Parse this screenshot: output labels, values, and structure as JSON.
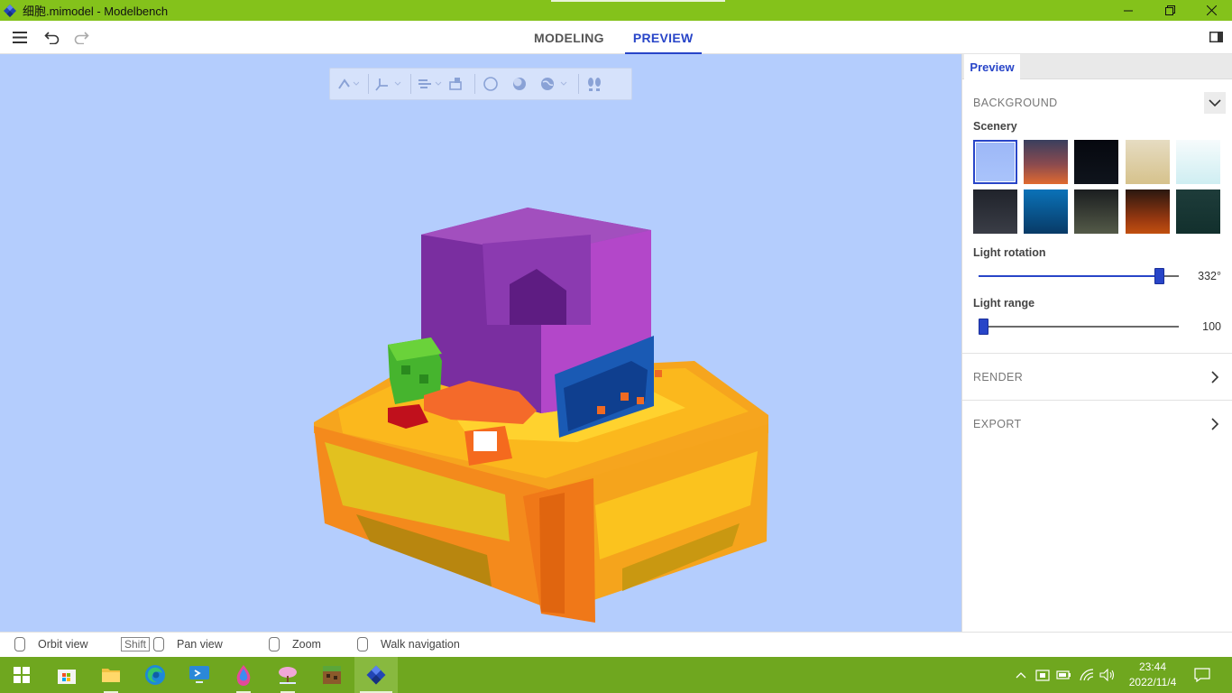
{
  "window": {
    "title": "细胞.mimodel - Modelbench",
    "icon": "modelbench-diamond-icon",
    "controls": [
      "minimize-icon",
      "restore-icon",
      "close-icon"
    ]
  },
  "toolbar": {
    "menu_icon": "hamburger-menu-icon",
    "undo_icon": "undo-icon",
    "redo_icon": "redo-icon",
    "tabs": [
      {
        "label": "MODELING",
        "active": false
      },
      {
        "label": "PREVIEW",
        "active": true
      }
    ],
    "panel_toggle_icon": "panel-toggle-icon"
  },
  "viewport": {
    "floating_toolbar": [
      "snap-icon",
      "axis-icon",
      "wind-icon",
      "texture-icon",
      "shape-icon",
      "shading-icon",
      "globe-icon",
      "footsteps-icon"
    ],
    "background_color": "#b4cdfd"
  },
  "panel": {
    "tab": "Preview",
    "background": {
      "header": "BACKGROUND",
      "scenery_label": "Scenery",
      "scenery": [
        {
          "name": "sky-blue",
          "selected": true
        },
        {
          "name": "dusk"
        },
        {
          "name": "night"
        },
        {
          "name": "sand"
        },
        {
          "name": "ice"
        },
        {
          "name": "dark-gray"
        },
        {
          "name": "ocean"
        },
        {
          "name": "olive-night"
        },
        {
          "name": "lava"
        },
        {
          "name": "deep-teal"
        }
      ],
      "light_rotation_label": "Light rotation",
      "light_rotation_value": "332°",
      "light_rotation_fraction": 0.922,
      "light_range_label": "Light range",
      "light_range_value": "100",
      "light_range_fraction": 0.0
    },
    "render_header": "RENDER",
    "export_header": "EXPORT"
  },
  "hints": {
    "orbit": "Orbit view",
    "shift_key": "Shift",
    "pan": "Pan view",
    "zoom": "Zoom",
    "walk": "Walk navigation"
  },
  "taskbar": {
    "apps": [
      "windows-start-icon",
      "microsoft-store-icon",
      "file-explorer-icon",
      "edge-icon",
      "remote-desktop-icon",
      "paint-icon",
      "tree-app-icon",
      "minecraft-icon",
      "modelbench-icon"
    ],
    "tray_icons": [
      "chevron-up-icon",
      "security-icon",
      "battery-icon",
      "wifi-icon",
      "volume-icon"
    ],
    "time": "23:44",
    "date": "2022/11/4",
    "notification_icon": "notification-icon"
  },
  "colors": {
    "accent": "#2845c8",
    "titlebar": "#84c21b",
    "taskbar": "#6fa71f"
  }
}
